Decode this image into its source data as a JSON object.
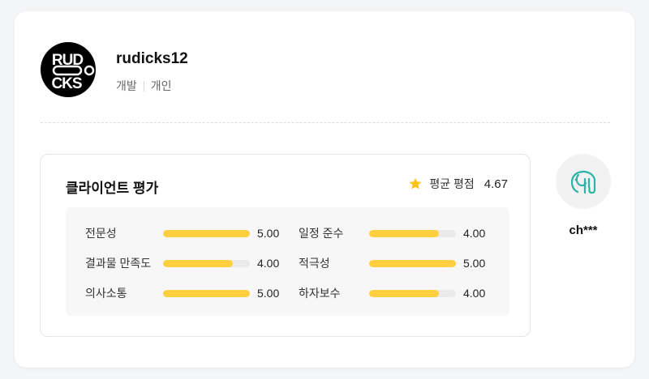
{
  "profile": {
    "logo_text_top": "RUD",
    "logo_text_bottom": "CKS",
    "username": "rudicks12",
    "tags": [
      "개발",
      "개인"
    ]
  },
  "review": {
    "title": "클라이언트 평가",
    "average_label": "평균 평점",
    "average_value": "4.67",
    "accent_color": "#ffcf3f",
    "items": [
      {
        "label": "전문성",
        "value": "5.00",
        "score": 5.0
      },
      {
        "label": "일정 준수",
        "value": "4.00",
        "score": 4.0
      },
      {
        "label": "결과물 만족도",
        "value": "4.00",
        "score": 4.0
      },
      {
        "label": "적극성",
        "value": "5.00",
        "score": 5.0
      },
      {
        "label": "의사소통",
        "value": "5.00",
        "score": 5.0
      },
      {
        "label": "하자보수",
        "value": "4.00",
        "score": 4.0
      }
    ]
  },
  "reviewer": {
    "name": "ch***",
    "avatar_icon": "elephant-icon",
    "avatar_color": "#2bb3a6"
  }
}
